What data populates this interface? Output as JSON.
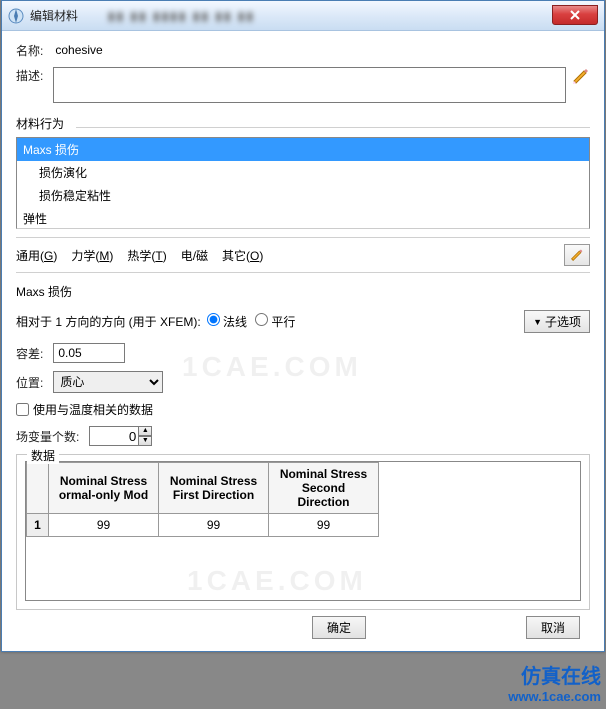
{
  "window": {
    "title": "编辑材料"
  },
  "labels": {
    "name": "名称:",
    "description": "描述:",
    "material_behavior": "材料行为",
    "section_title": "Maxs 损伤",
    "direction_label": "相对于 1 方向的方向 (用于 XFEM):",
    "radio_normal": "法线",
    "radio_parallel": "平行",
    "suboptions": "子选项",
    "tolerance": "容差:",
    "position": "位置:",
    "use_temp_data": "使用与温度相关的数据",
    "field_var_count": "场变量个数:",
    "data": "数据"
  },
  "values": {
    "name": "cohesive",
    "description": "",
    "tolerance": "0.05",
    "position": "质心",
    "use_temp_data": false,
    "field_var_count": "0"
  },
  "behaviors": [
    {
      "label": "Maxs 损伤",
      "selected": true,
      "indent": false
    },
    {
      "label": "损伤演化",
      "selected": false,
      "indent": true
    },
    {
      "label": "损伤稳定粘性",
      "selected": false,
      "indent": true
    },
    {
      "label": "弹性",
      "selected": false,
      "indent": false
    }
  ],
  "tabs": [
    {
      "label": "通用",
      "mnemonic": "G"
    },
    {
      "label": "力学",
      "mnemonic": "M"
    },
    {
      "label": "热学",
      "mnemonic": "T"
    },
    {
      "label": "电/磁",
      "mnemonic": ""
    },
    {
      "label": "其它",
      "mnemonic": "O"
    }
  ],
  "table": {
    "headers": [
      {
        "line1": "Nominal Stress",
        "line2": "ormal-only Mod"
      },
      {
        "line1": "Nominal Stress",
        "line2": "First Direction"
      },
      {
        "line1": "Nominal Stress",
        "line2": "Second Direction"
      }
    ],
    "rows": [
      {
        "n": "1",
        "cells": [
          "99",
          "99",
          "99"
        ]
      }
    ]
  },
  "buttons": {
    "ok": "确定",
    "cancel": "取消"
  },
  "watermarks": {
    "w1": "1CAE.COM",
    "w2": "1CAE.COM"
  },
  "brand": {
    "cn": "仿真在线",
    "url": "www.1cae.com"
  }
}
